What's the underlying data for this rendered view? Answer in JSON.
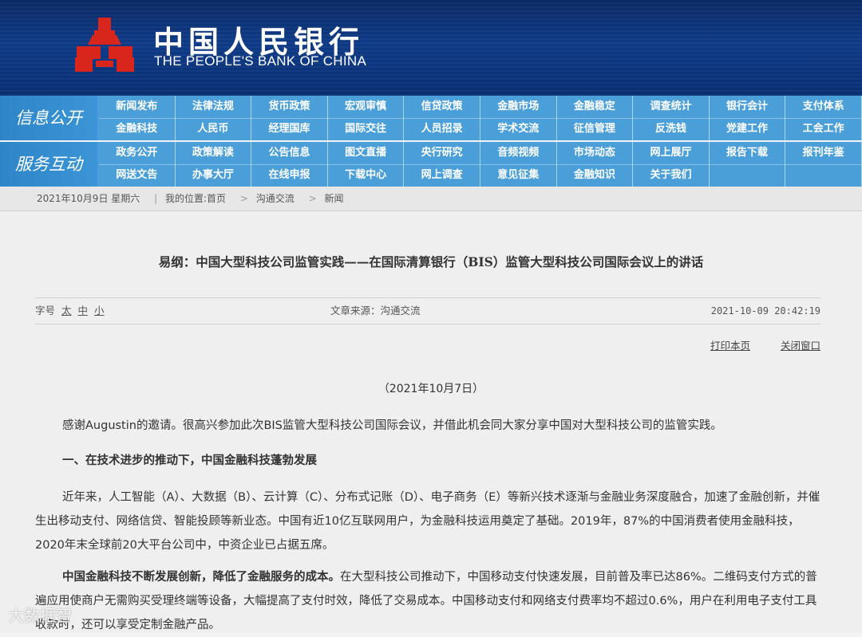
{
  "header": {
    "title_cn": "中国人民银行",
    "title_en": "THE PEOPLE'S BANK OF CHINA"
  },
  "nav": {
    "section1": {
      "label": "信息公开",
      "items": [
        "新闻发布",
        "法律法规",
        "货币政策",
        "宏观审慎",
        "信贷政策",
        "金融市场",
        "金融稳定",
        "调查统计",
        "银行会计",
        "支付体系",
        "金融科技",
        "人民币",
        "经理国库",
        "国际交往",
        "人员招录",
        "学术交流",
        "征信管理",
        "反洗钱",
        "党建工作",
        "工会工作"
      ]
    },
    "section2": {
      "label": "服务互动",
      "items": [
        "政务公开",
        "政策解读",
        "公告信息",
        "图文直播",
        "央行研究",
        "音频视频",
        "市场动态",
        "网上展厅",
        "报告下载",
        "报刊年鉴",
        "网送文告",
        "办事大厅",
        "在线申报",
        "下载中心",
        "网上调查",
        "意见征集",
        "金融知识",
        "关于我们",
        "",
        ""
      ]
    }
  },
  "breadcrumb": {
    "date": "2021年10月9日 星期六",
    "location_label": "我的位置:首页",
    "path1": "沟通交流",
    "path2": "新闻"
  },
  "article": {
    "title": "易纲：中国大型科技公司监管实践——在国际清算银行（BIS）监管大型科技公司国际会议上的讲话",
    "fontsize_label": "字号",
    "fontsize_large": "太",
    "fontsize_medium": "中",
    "fontsize_small": "小",
    "source": "文章来源：沟通交流",
    "timestamp": "2021-10-09 20:42:19",
    "print_label": "打印本页",
    "close_label": "关闭窗口",
    "date_line": "（2021年10月7日）",
    "p1": "感谢Augustin的邀请。很高兴参加此次BIS监管大型科技公司国际会议，并借此机会同大家分享中国对大型科技公司的监管实践。",
    "heading1": "一、在技术进步的推动下，中国金融科技蓬勃发展",
    "p2": "近年来，人工智能（A）、大数据（B）、云计算（C）、分布式记账（D）、电子商务（E）等新兴技术逐渐与金融业务深度融合，加速了金融创新，并催生出移动支付、网络信贷、智能投顾等新业态。中国有近10亿互联网用户，为金融科技运用奠定了基础。2019年，87%的中国消费者使用金融科技，2020年末全球前20大平台公司中，中资企业已占据五席。",
    "p3_bold": "中国金融科技不断发展创新，降低了金融服务的成本。",
    "p3_rest": "在大型科技公司推动下，中国移动支付快速发展，目前普及率已达86%。二维码支付方式的普遍应用使商户无需购买受理终端等设备，大幅提高了支付时效，降低了交易成本。中国移动支付和网络支付费率均不超过0.6%，用户在利用电子支付工具收款时，还可以享受定制金融产品。"
  },
  "watermark": "大数据智",
  "colors": {
    "header_bg": "#0e3a86",
    "nav_bg": "#4b9fd9",
    "logo_red": "#d8261c"
  }
}
